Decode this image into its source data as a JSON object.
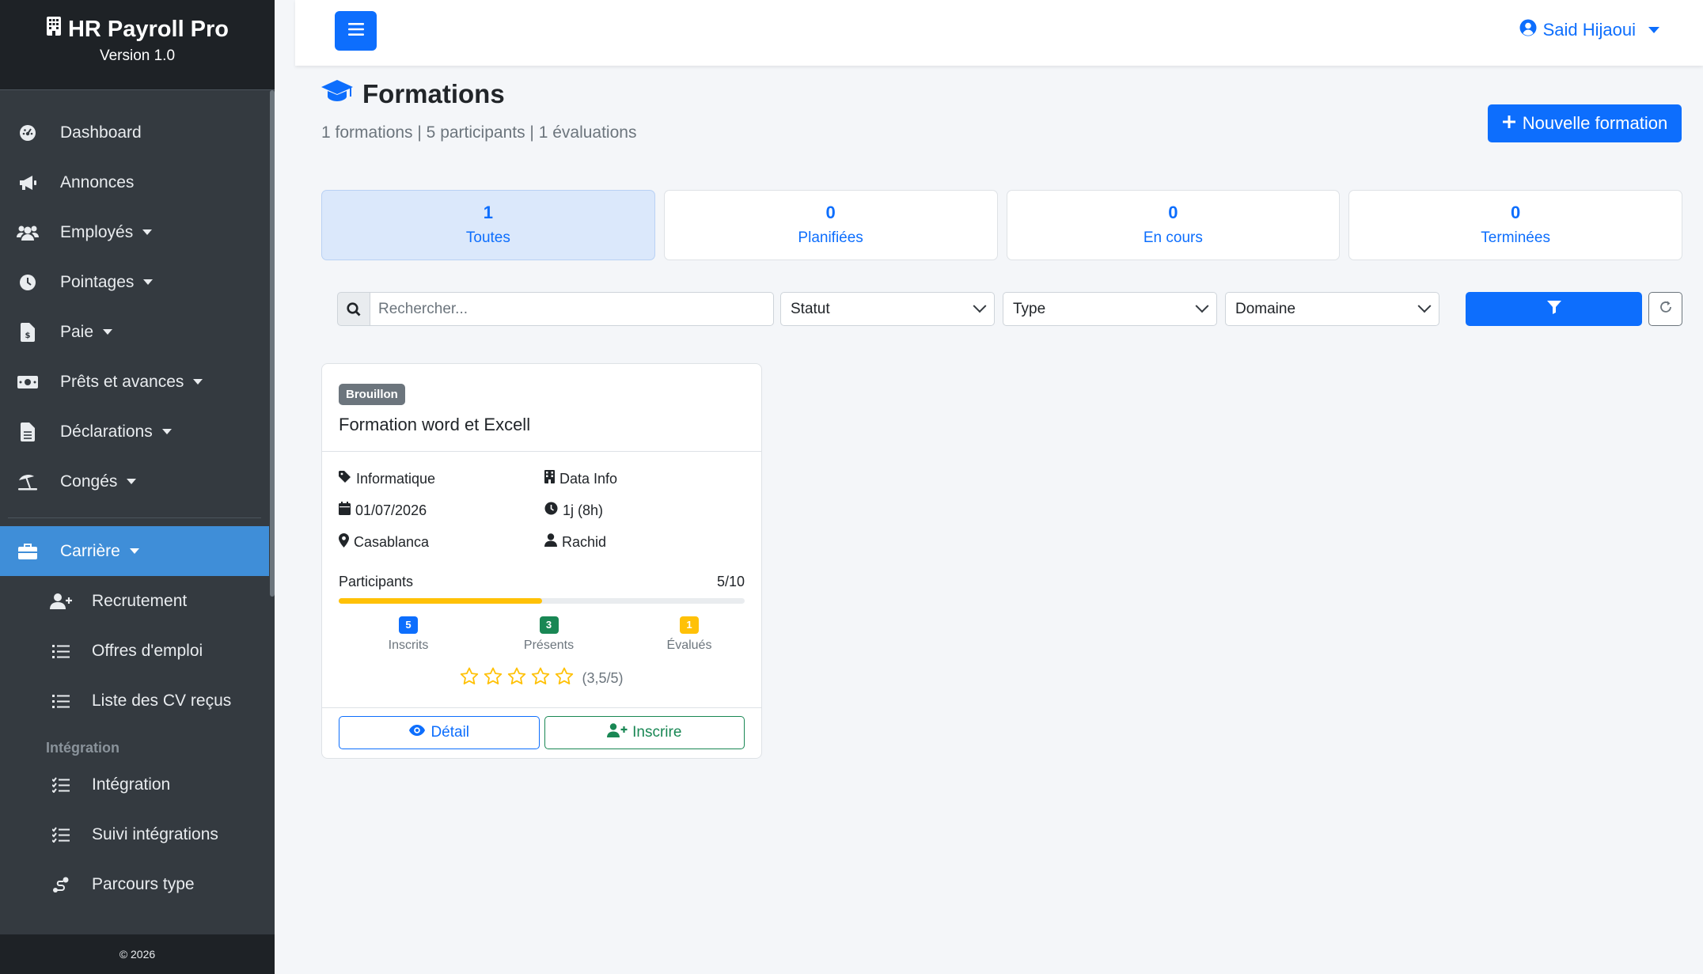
{
  "brand": {
    "title": "HR Payroll Pro",
    "version": "Version 1.0"
  },
  "sidebar": {
    "items": [
      {
        "label": "Dashboard",
        "icon": "gauge-icon"
      },
      {
        "label": "Annonces",
        "icon": "megaphone-icon"
      },
      {
        "label": "Employés",
        "icon": "users-icon"
      },
      {
        "label": "Pointages",
        "icon": "clock-icon"
      },
      {
        "label": "Paie",
        "icon": "invoice-dollar-icon"
      },
      {
        "label": "Prêts et avances",
        "icon": "money-icon"
      },
      {
        "label": "Déclarations",
        "icon": "document-icon"
      },
      {
        "label": "Congés",
        "icon": "umbrella-beach-icon"
      }
    ],
    "active": {
      "label": "Carrière",
      "icon": "briefcase-icon"
    },
    "subitems": [
      {
        "label": "Recrutement",
        "icon": "user-plus-icon"
      },
      {
        "label": "Offres d'emploi",
        "icon": "list-icon"
      },
      {
        "label": "Liste des CV reçus",
        "icon": "list-icon"
      }
    ],
    "section_integration": "Intégration",
    "integration_items": [
      {
        "label": "Intégration",
        "icon": "list-check-icon"
      },
      {
        "label": "Suivi intégrations",
        "icon": "list-check-icon"
      },
      {
        "label": "Parcours type",
        "icon": "route-icon"
      }
    ],
    "footer": "© 2026"
  },
  "topbar": {
    "user": "Said Hijaoui"
  },
  "page": {
    "title": "Formations",
    "subtitle": "1 formations | 5 participants | 1 évaluations",
    "new_button": "Nouvelle formation"
  },
  "stats": [
    {
      "value": "1",
      "label": "Toutes"
    },
    {
      "value": "0",
      "label": "Planifiées"
    },
    {
      "value": "0",
      "label": "En cours"
    },
    {
      "value": "0",
      "label": "Terminées"
    }
  ],
  "filters": {
    "search_placeholder": "Rechercher...",
    "statut": "Statut",
    "type": "Type",
    "domaine": "Domaine"
  },
  "card": {
    "badge": "Brouillon",
    "title": "Formation word et Excell",
    "domain": "Informatique",
    "organisme": "Data Info",
    "date": "01/07/2026",
    "duration": "1j (8h)",
    "location": "Casablanca",
    "trainer": "Rachid",
    "participants_label": "Participants",
    "participants_count": "5/10",
    "participants_fraction": 0.5,
    "inscrits_count": "5",
    "inscrits_label": "Inscrits",
    "presents_count": "3",
    "presents_label": "Présents",
    "evalues_count": "1",
    "evalues_label": "Évalués",
    "rating_text": "(3,5/5)",
    "detail_button": "Détail",
    "inscrire_button": "Inscrire"
  },
  "colors": {
    "primary": "#0d6efd",
    "sidebar": "#343a40",
    "sidebar_active": "#3f8ed8",
    "progress": "#ffc107",
    "success": "#198754",
    "warning": "#ffc107",
    "badge_gray": "#6c757d"
  }
}
